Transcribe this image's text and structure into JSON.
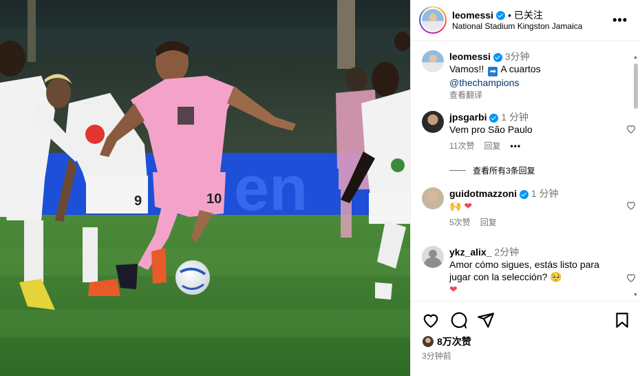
{
  "post": {
    "username": "leomessi",
    "follow_status": "已关注",
    "dot": "•",
    "location": "National Stadium Kingston Jamaica",
    "more_icon": "more-horizontal-icon"
  },
  "photo": {
    "banner_text": "en",
    "jersey_number_player": "10",
    "jersey_number_opponent": "9"
  },
  "caption": {
    "username": "leomessi",
    "time": "3分钟",
    "text_1": "Vamos!!",
    "arrow_emoji": "➡",
    "text_2": "A cuartos",
    "mention": "@thechampions",
    "see_translation": "查看翻译"
  },
  "comments": [
    {
      "username": "jpsgarbi",
      "verified": true,
      "time": "1 分钟",
      "text": "Vem pro São Paulo",
      "likes": "11次赞",
      "reply": "回复",
      "more": "•••"
    },
    {
      "username": "guidotmazzoni",
      "verified": true,
      "time": "1 分钟",
      "text": "🙌 ❤",
      "likes": "5次赞",
      "reply": "回复"
    },
    {
      "username": "ykz_alix_",
      "verified": false,
      "time": "2分钟",
      "text": "Amor cómo sigues, estás listo para jugar con la selección? 🥺",
      "text_2": "❤"
    }
  ],
  "view_replies": "查看所有3条回复",
  "actions": {
    "likes_count": "8万次赞",
    "post_time": "3分钟前"
  },
  "colors": {
    "accent": "#0095f6",
    "like_red": "#ed4956",
    "muted": "#737373",
    "mention": "#00376b"
  }
}
